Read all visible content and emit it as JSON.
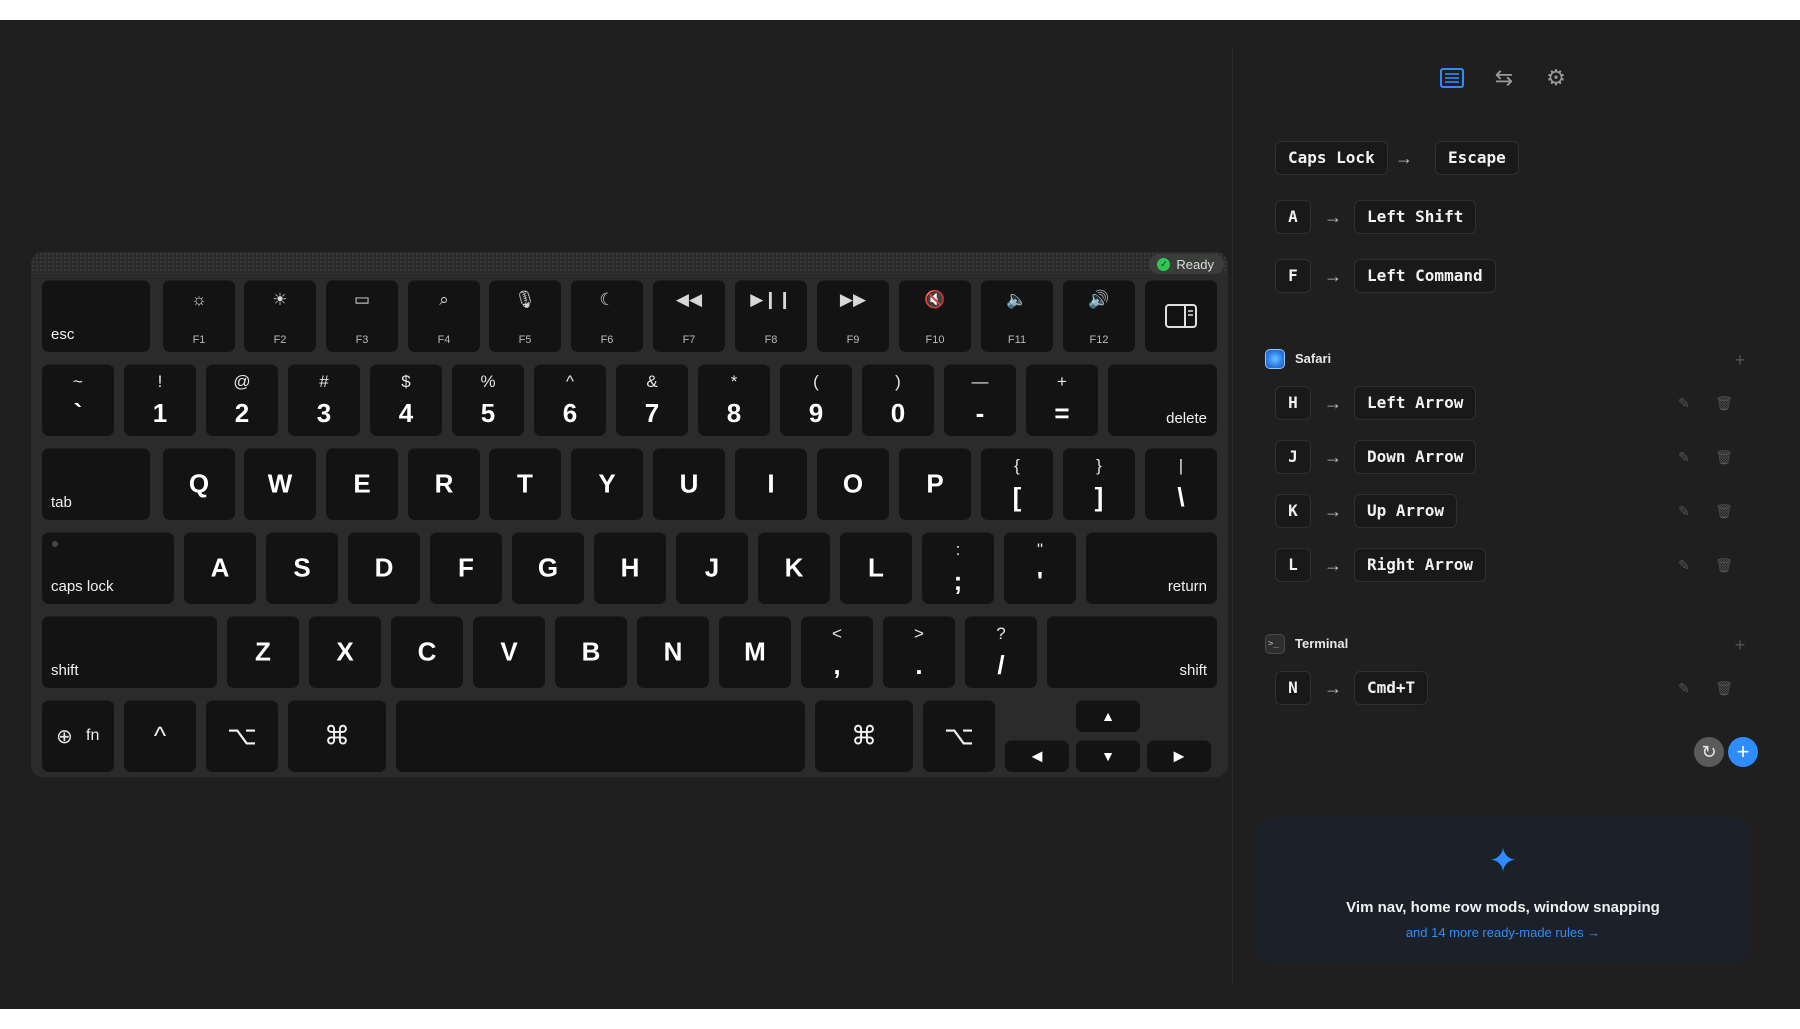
{
  "status": {
    "label": "Ready",
    "color": "#30c653"
  },
  "keyboard": {
    "fn_row": [
      {
        "label": "esc",
        "icon": ""
      },
      {
        "label": "F1",
        "icon": "☼"
      },
      {
        "label": "F2",
        "icon": "☀"
      },
      {
        "label": "F3",
        "icon": "▭"
      },
      {
        "label": "F4",
        "icon": "⌕"
      },
      {
        "label": "F5",
        "icon": "🎙"
      },
      {
        "label": "F6",
        "icon": "☾"
      },
      {
        "label": "F7",
        "icon": "◀◀"
      },
      {
        "label": "F8",
        "icon": "▶❙❙"
      },
      {
        "label": "F9",
        "icon": "▶▶"
      },
      {
        "label": "F10",
        "icon": "🔇"
      },
      {
        "label": "F11",
        "icon": "🔈"
      },
      {
        "label": "F12",
        "icon": "🔊"
      }
    ],
    "num_row": [
      {
        "shift": "~",
        "main": "`"
      },
      {
        "shift": "!",
        "main": "1"
      },
      {
        "shift": "@",
        "main": "2"
      },
      {
        "shift": "#",
        "main": "3"
      },
      {
        "shift": "$",
        "main": "4"
      },
      {
        "shift": "%",
        "main": "5"
      },
      {
        "shift": "^",
        "main": "6"
      },
      {
        "shift": "&",
        "main": "7"
      },
      {
        "shift": "*",
        "main": "8"
      },
      {
        "shift": "(",
        "main": "9"
      },
      {
        "shift": ")",
        "main": "0"
      },
      {
        "shift": "—",
        "main": "-"
      },
      {
        "shift": "+",
        "main": "="
      }
    ],
    "delete": "delete",
    "tab": "tab",
    "q_row": [
      "Q",
      "W",
      "E",
      "R",
      "T",
      "Y",
      "U",
      "I",
      "O",
      "P"
    ],
    "q_sym": [
      {
        "shift": "{",
        "main": "["
      },
      {
        "shift": "}",
        "main": "]"
      },
      {
        "shift": "|",
        "main": "\\"
      }
    ],
    "caps": "caps lock",
    "a_row": [
      "A",
      "S",
      "D",
      "F",
      "G",
      "H",
      "J",
      "K",
      "L"
    ],
    "a_sym": [
      {
        "shift": ":",
        "main": ";"
      },
      {
        "shift": "\"",
        "main": "'"
      }
    ],
    "return": "return",
    "shift_left": "shift",
    "z_row": [
      "Z",
      "X",
      "C",
      "V",
      "B",
      "N",
      "M"
    ],
    "z_sym": [
      {
        "shift": "<",
        "main": ","
      },
      {
        "shift": ">",
        "main": "."
      },
      {
        "shift": "?",
        "main": "/"
      }
    ],
    "shift_right": "shift",
    "fn": "fn",
    "ctrl": "^",
    "opt": "⌥",
    "cmd": "⌘",
    "arrows": {
      "up": "▲",
      "down": "▼",
      "left": "◀",
      "right": "▶"
    }
  },
  "global_rules": [
    {
      "from": "Caps Lock",
      "to": "Escape"
    },
    {
      "from": "A",
      "to": "Left Shift"
    },
    {
      "from": "F",
      "to": "Left Command"
    }
  ],
  "groups": [
    {
      "name": "Safari",
      "rules": [
        {
          "from": "H",
          "to": "Left Arrow"
        },
        {
          "from": "J",
          "to": "Down Arrow"
        },
        {
          "from": "K",
          "to": "Up Arrow"
        },
        {
          "from": "L",
          "to": "Right Arrow"
        }
      ]
    },
    {
      "name": "Terminal",
      "rules": [
        {
          "from": "N",
          "to": "Cmd+T"
        }
      ]
    }
  ],
  "arrow_glyph": "→",
  "presets": {
    "headline": "Vim nav, home row mods, window snapping",
    "link": "and 14 more ready-made rules →"
  },
  "colors": {
    "accent": "#2f8cff",
    "background": "#1f1f1f",
    "key": "#131313"
  },
  "icons": {
    "rules_view": "list-icon",
    "swap": "swap-arrows-icon",
    "settings": "gear-icon",
    "reset": "reset-icon",
    "add": "plus-icon",
    "edit": "pencil-icon",
    "delete": "trash-icon"
  }
}
